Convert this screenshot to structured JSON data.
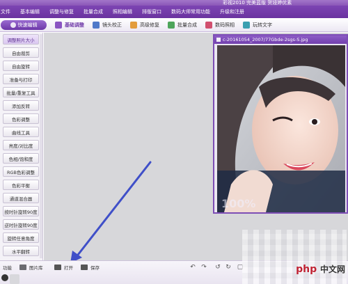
{
  "window": {
    "title": "彩视2010 完美蓝版 贺娅婷优素"
  },
  "menu": [
    "文件",
    "基本编辑",
    "调整与修复",
    "批量合成",
    "照相编辑",
    "排版窗口",
    "数码大师常用功能",
    "升级和注册"
  ],
  "toolbar": {
    "logo_label": "快速编辑",
    "items": [
      {
        "label": "基础调整",
        "icon": "adjust-icon"
      },
      {
        "label": "镜头校正",
        "icon": "lens-icon"
      },
      {
        "label": "高级修复",
        "icon": "repair-icon"
      },
      {
        "label": "批量合成",
        "icon": "batch-icon"
      },
      {
        "label": "数码照相",
        "icon": "camera-icon"
      },
      {
        "label": "玩转文字",
        "icon": "text-icon"
      }
    ]
  },
  "sidebar": {
    "items": [
      "调整照片大小",
      "自由裁剪",
      "自由旋转",
      "准备与打印",
      "批量/重复工具",
      "添加反转",
      "色彩调整",
      "曲线工具",
      "亮度/对比度",
      "色相/饱和度",
      "RGB色彩调整",
      "色彩平衡",
      "通道混合器",
      "按时针旋转90度",
      "逆时针旋转90度",
      "旋转任意角度",
      "水平翻转"
    ]
  },
  "image_window": {
    "title": "c-20161054_2007/77Gbde-2sgs-S.jpg",
    "zoom": "100%"
  },
  "bottom": {
    "function_label": "功能",
    "library_label": "图片库",
    "open_label": "打开",
    "save_label": "保存"
  },
  "watermark": {
    "brand": "php",
    "site": "中文网"
  },
  "colors": {
    "accent": "#7b44b0",
    "canvas": "#d7d7da",
    "arrow": "#3f4fc8"
  }
}
